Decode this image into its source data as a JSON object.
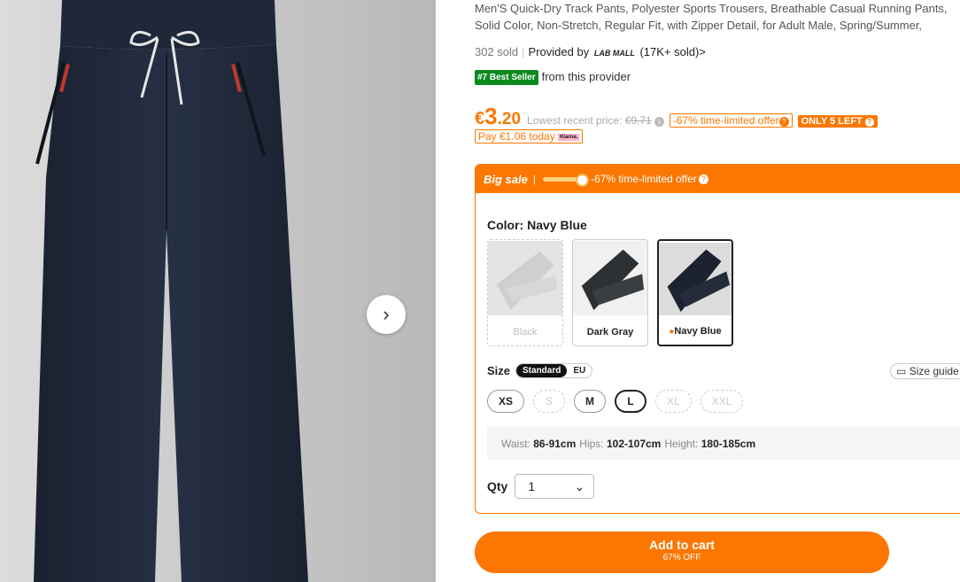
{
  "product": {
    "title": "Men'S Quick-Dry Track Pants, Polyester Sports Trousers, Breathable Casual Running Pants, Solid Color, Non-Stretch, Regular Fit, with Zipper Detail, for Adult Male, Spring/Summer,",
    "sold": "302 sold",
    "provided_by": "Provided by",
    "provider_logo": "LAB MALL",
    "provider_sold": "(17K+ sold)",
    "provider_chevron": ">",
    "best_seller_badge": "#7 Best Seller",
    "best_seller_text": "from this provider"
  },
  "price": {
    "currency": "€",
    "integer": "3",
    "decimal": ".20",
    "lowest_label": "Lowest recent price:",
    "lowest_value": "€9.71",
    "offer": "-67% time-limited offer",
    "only_left": "ONLY 5 LEFT",
    "pay_today": "Pay €1.06 today",
    "klarna": "Klarna."
  },
  "sale": {
    "label": "Big sale",
    "divider": "|",
    "offer": "-67% time-limited offer"
  },
  "color": {
    "label": "Color: Navy Blue",
    "options": [
      {
        "name": "Black",
        "state": "disabled",
        "fill": "#c8c8c8"
      },
      {
        "name": "Dark Gray",
        "state": "available",
        "fill": "#2e3133"
      },
      {
        "name": "Navy Blue",
        "state": "selected",
        "fill": "#1c2230"
      }
    ]
  },
  "size": {
    "label": "Size",
    "standard": "Standard",
    "eu": "EU",
    "guide": "Size guide",
    "options": [
      {
        "name": "XS",
        "state": "available"
      },
      {
        "name": "S",
        "state": "disabled"
      },
      {
        "name": "M",
        "state": "available"
      },
      {
        "name": "L",
        "state": "selected"
      },
      {
        "name": "XL",
        "state": "disabled"
      },
      {
        "name": "XXL",
        "state": "disabled"
      }
    ],
    "measure": {
      "waist_label": "Waist:",
      "waist": "86-91cm",
      "hips_label": "Hips:",
      "hips": "102-107cm",
      "height_label": "Height:",
      "height": "180-185cm"
    }
  },
  "qty": {
    "label": "Qty",
    "value": "1",
    "chevron": "⌄"
  },
  "cart": {
    "label": "Add to cart",
    "sub": "67% OFF"
  },
  "gallery": {
    "next_icon": "›"
  },
  "colors": {
    "accent": "#fb7701",
    "green": "#0a8a1f",
    "pants": "#1f2736"
  }
}
